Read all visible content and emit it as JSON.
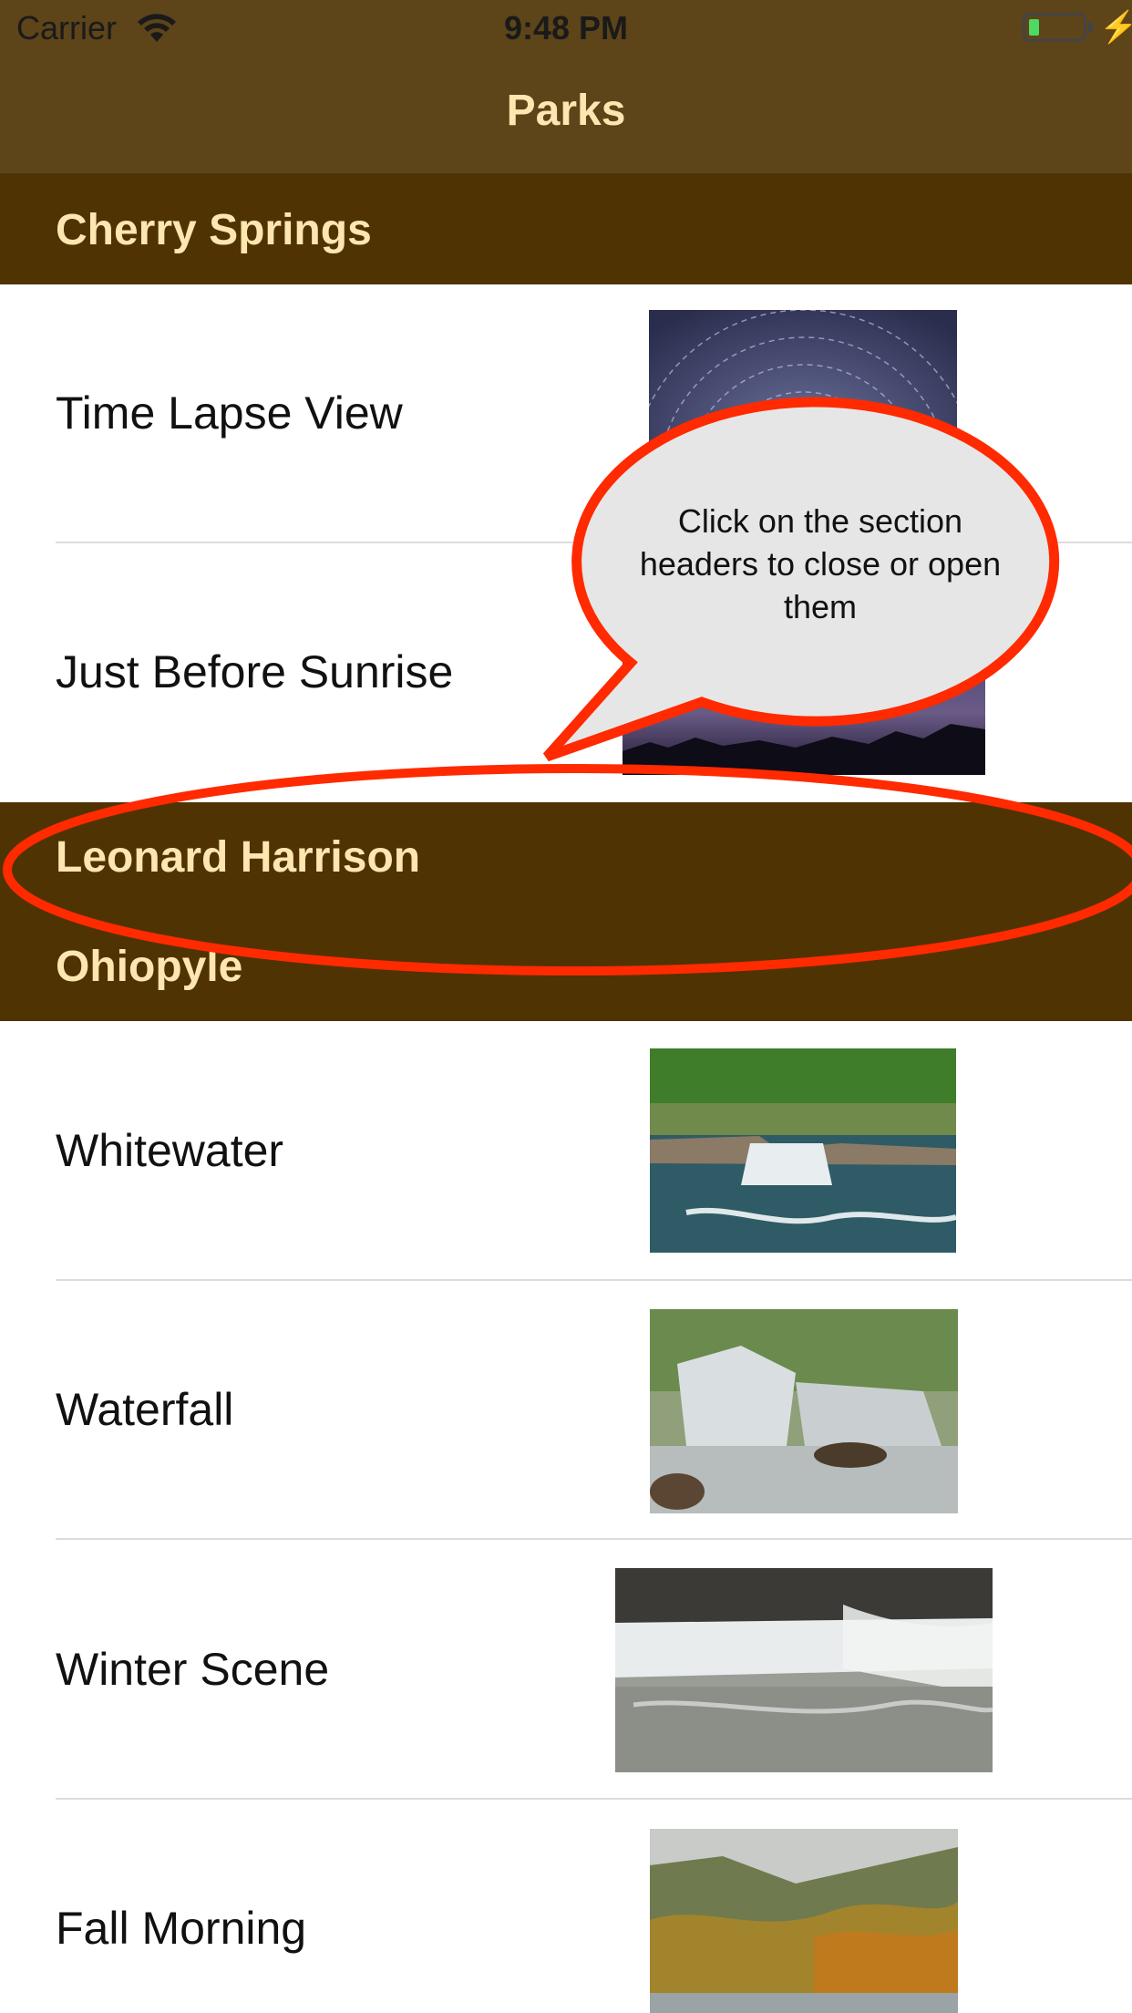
{
  "status_bar": {
    "carrier": "Carrier",
    "time": "9:48 PM",
    "battery_level": 0.2
  },
  "nav": {
    "title": "Parks"
  },
  "sections": [
    {
      "title": "Cherry Springs",
      "rows": [
        {
          "label": "Time Lapse View",
          "thumbnail": "star-trails-photo"
        },
        {
          "label": "Just Before Sunrise",
          "thumbnail": "night-sky-treeline-photo"
        }
      ]
    },
    {
      "title": "Leonard Harrison",
      "rows": []
    },
    {
      "title": "Ohiopyle",
      "rows": [
        {
          "label": "Whitewater",
          "thumbnail": "whitewater-falls-photo"
        },
        {
          "label": "Waterfall",
          "thumbnail": "forest-waterfall-photo"
        },
        {
          "label": "Winter Scene",
          "thumbnail": "snowy-river-photo"
        },
        {
          "label": "Fall Morning",
          "thumbnail": "autumn-valley-photo"
        }
      ]
    }
  ],
  "callout": {
    "text": "Click on the section headers to close or open them",
    "stroke_color": "#ff2a00",
    "fill_color": "#e6e6e6"
  },
  "colors": {
    "nav_bg": "#5d4419",
    "header_bg": "#4f3302",
    "header_text": "#fde6b0"
  }
}
